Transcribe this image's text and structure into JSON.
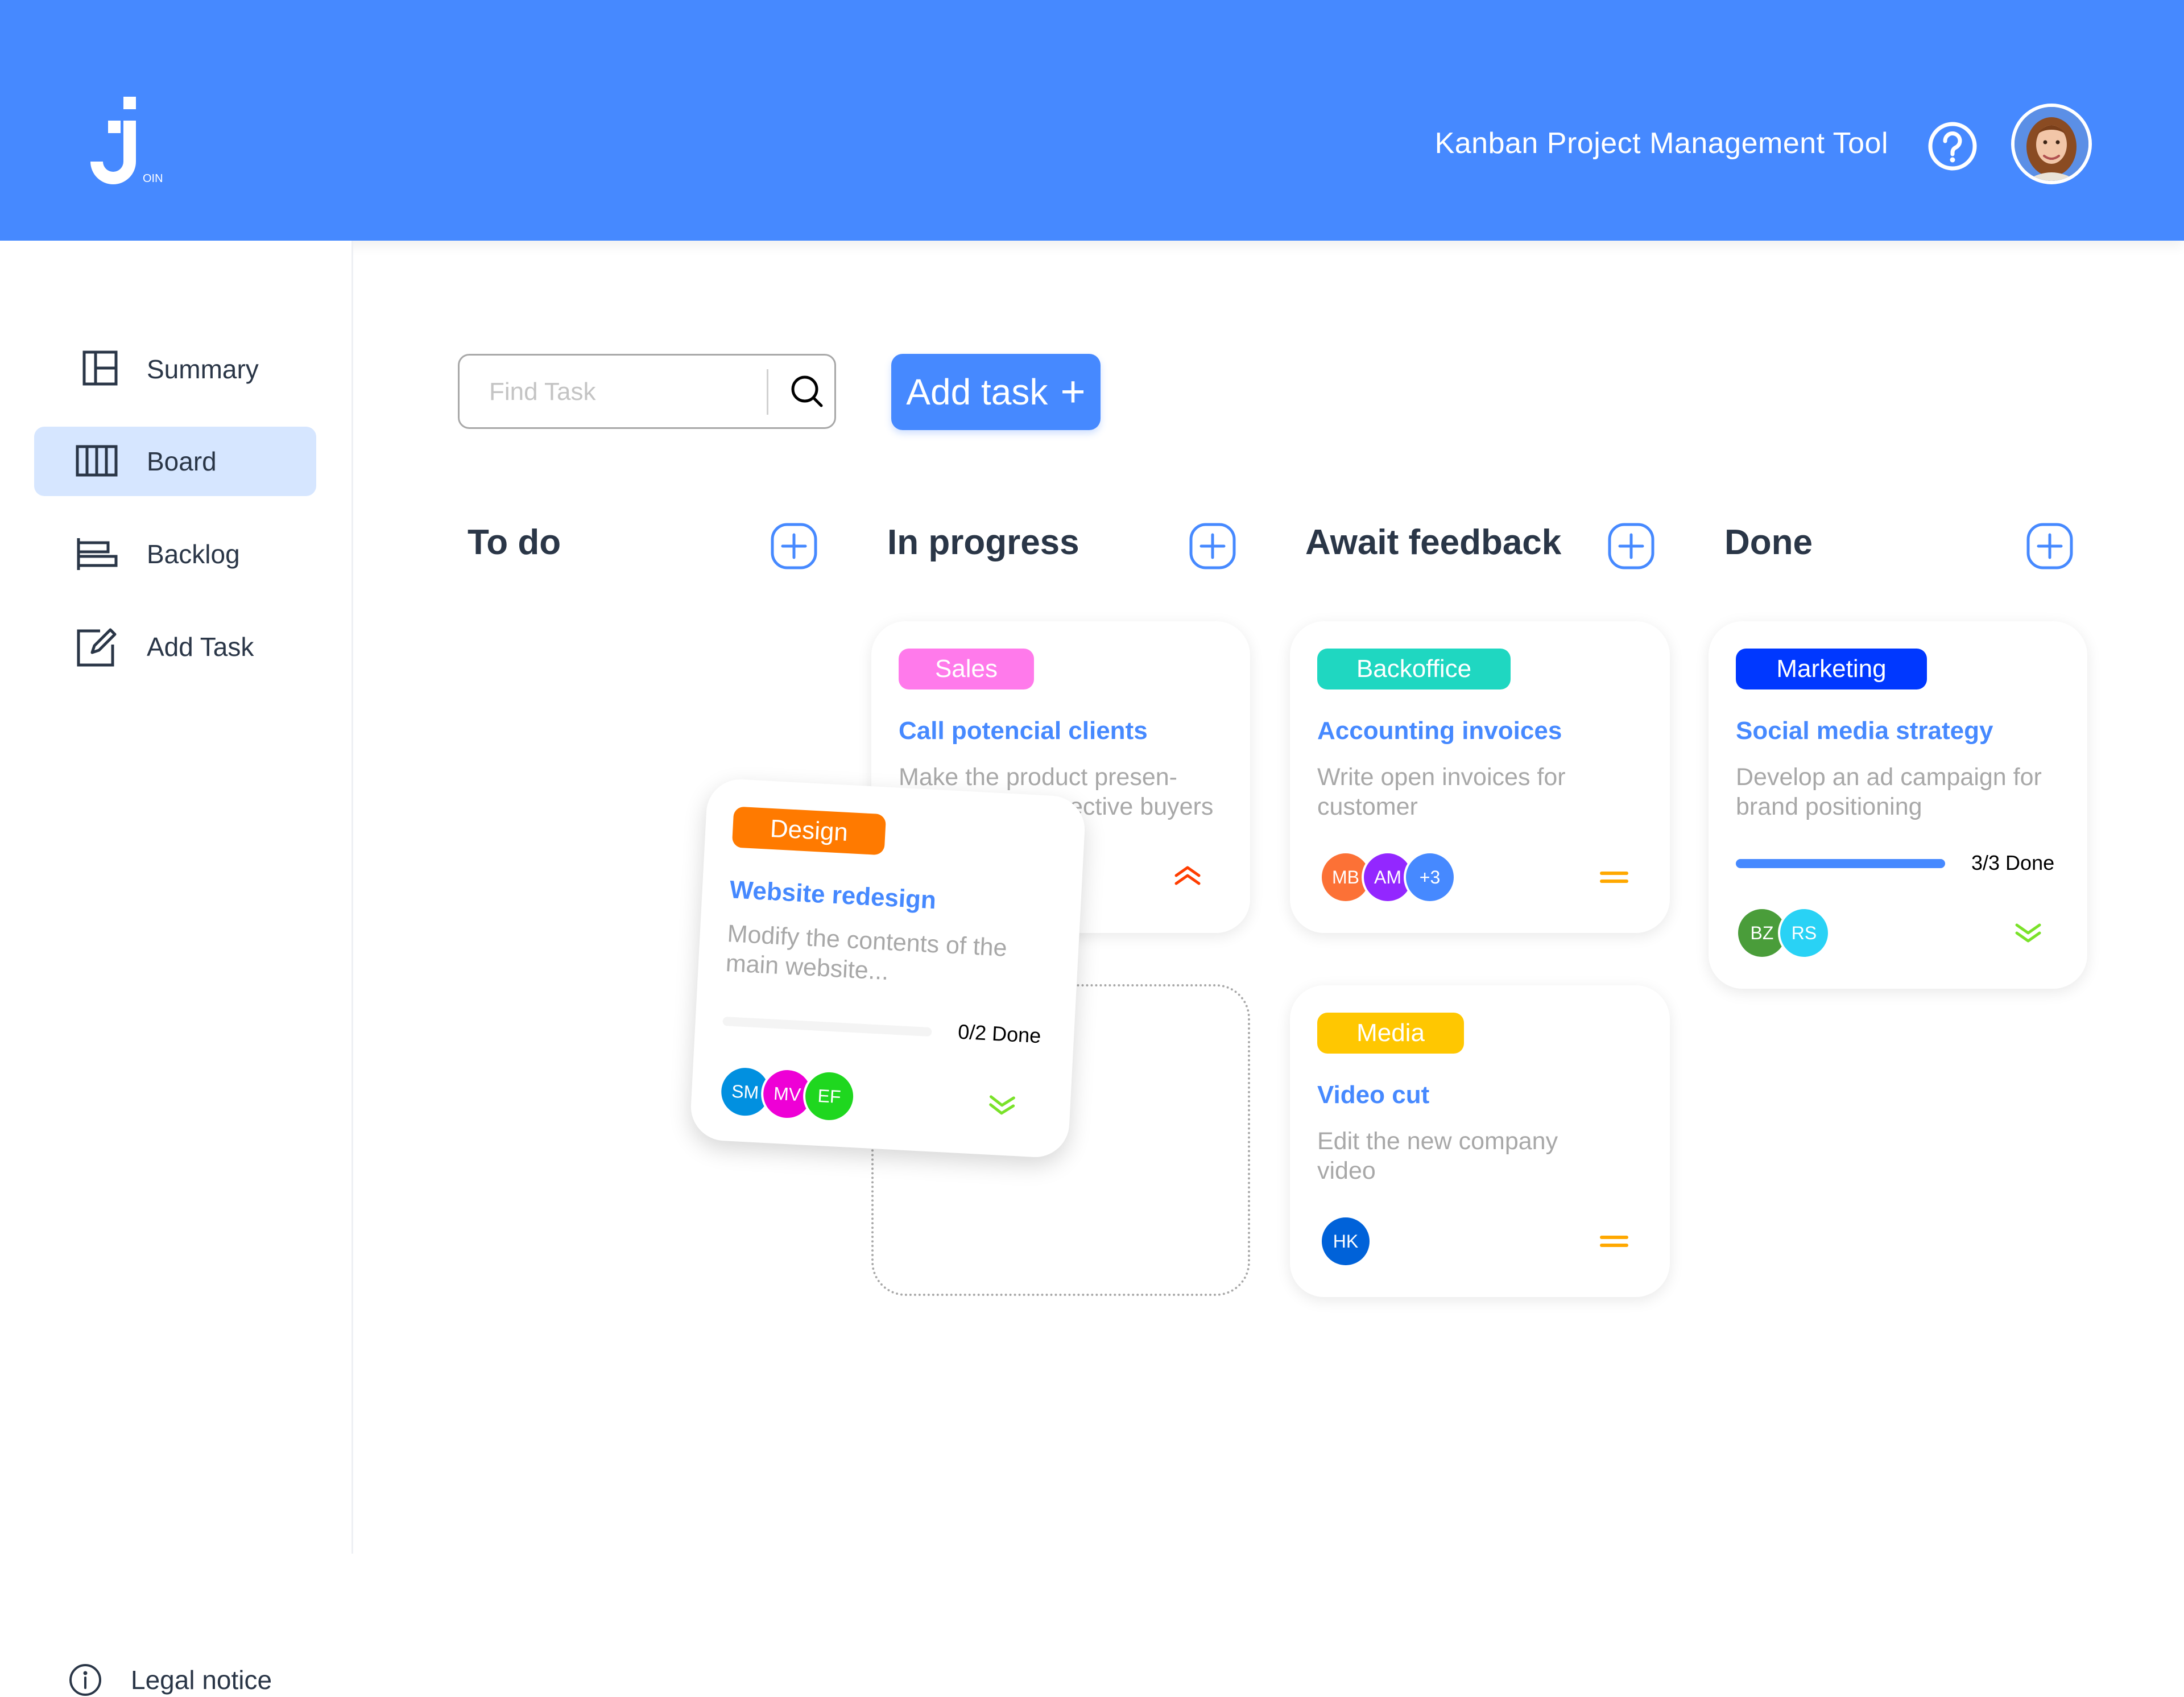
{
  "app": {
    "header_title": "Kanban Project Management Tool",
    "logo_icon": "join-logo-icon",
    "help_icon": "help-circle-icon",
    "user_avatar": "user-profile-photo"
  },
  "sidebar": {
    "items": [
      {
        "label": "Summary",
        "icon": "summary-icon",
        "active": false
      },
      {
        "label": "Board",
        "icon": "board-icon",
        "active": true
      },
      {
        "label": "Backlog",
        "icon": "backlog-icon",
        "active": false
      },
      {
        "label": "Add Task",
        "icon": "edit-icon",
        "active": false
      }
    ],
    "legal": {
      "label": "Legal notice",
      "icon": "info-icon"
    }
  },
  "toolbar": {
    "search_placeholder": "Find Task",
    "search_value": "",
    "add_task_label": "Add task",
    "add_task_icon": "plus-icon"
  },
  "columns": [
    {
      "title": "To do"
    },
    {
      "title": "In progress"
    },
    {
      "title": "Await feedback"
    },
    {
      "title": "Done"
    }
  ],
  "cards": {
    "sales": {
      "tag": "Sales",
      "tag_color": "#ff7aeb",
      "title": "Call potencial clients",
      "desc_line1": "Make the product presen-",
      "desc_line2": "ective buyers",
      "priority": "urgent",
      "priority_color": "#ff3d00"
    },
    "design": {
      "tag": "Design",
      "tag_color": "#ff7a00",
      "title": "Website redesign",
      "desc": "Modify the contents of the main website...",
      "progress": "0/2 Done",
      "progress_fraction": 0,
      "assignees": [
        {
          "initials": "SM",
          "color": "#0190e0"
        },
        {
          "initials": "MV",
          "color": "#ee00d6"
        },
        {
          "initials": "EF",
          "color": "#1fd71f"
        }
      ],
      "priority": "low",
      "priority_color": "#7ae229"
    },
    "accounting": {
      "tag": "Backoffice",
      "tag_color": "#1fd7c1",
      "title": "Accounting invoices",
      "desc": "Write open invoices for customer",
      "assignees": [
        {
          "initials": "MB",
          "color": "#fc7136"
        },
        {
          "initials": "AM",
          "color": "#9327ff"
        },
        {
          "initials": "+3",
          "color": "#4689ff"
        }
      ],
      "priority": "medium",
      "priority_color": "#ffa800"
    },
    "video": {
      "tag": "Media",
      "tag_color": "#ffc701",
      "title": "Video cut",
      "desc": "Edit the new company video",
      "assignees": [
        {
          "initials": "HK",
          "color": "#0062d9"
        }
      ],
      "priority": "medium",
      "priority_color": "#ffa800"
    },
    "social": {
      "tag": "Marketing",
      "tag_color": "#0038ff",
      "title": "Social media strategy",
      "desc": "Develop an ad campaign for brand positioning",
      "progress": "3/3 Done",
      "progress_fraction": 1,
      "assignees": [
        {
          "initials": "BZ",
          "color": "#4a9d3a"
        },
        {
          "initials": "RS",
          "color": "#29d2f5"
        }
      ],
      "priority": "low",
      "priority_color": "#7ae229"
    }
  }
}
